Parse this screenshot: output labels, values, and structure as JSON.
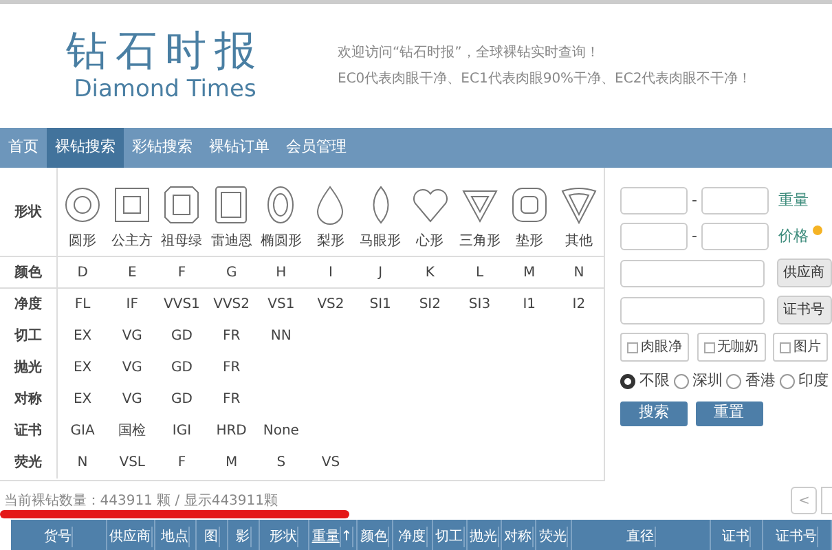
{
  "header": {
    "logo_title": "钻石时报",
    "logo_subtitle": "Diamond Times",
    "notices": [
      "欢迎访问“钻石时报”，全球裸钻实时查询！",
      "EC0代表肉眼干净、EC1代表肉眼90%干净、EC2代表肉眼不干净！"
    ]
  },
  "nav": [
    {
      "label": "首页",
      "selected": false
    },
    {
      "label": "裸钻搜索",
      "selected": true
    },
    {
      "label": "彩钻搜索",
      "selected": false
    },
    {
      "label": "裸钻订单",
      "selected": false
    },
    {
      "label": "会员管理",
      "selected": false
    }
  ],
  "filters": {
    "shape_label": "形状",
    "shapes": [
      "圆形",
      "公主方",
      "祖母绿",
      "雷迪恩",
      "椭圆形",
      "梨形",
      "马眼形",
      "心形",
      "三角形",
      "垫形",
      "其他"
    ],
    "rows": [
      {
        "label": "颜色",
        "options": [
          "D",
          "E",
          "F",
          "G",
          "H",
          "I",
          "J",
          "K",
          "L",
          "M",
          "N"
        ]
      },
      {
        "label": "净度",
        "options": [
          "FL",
          "IF",
          "VVS1",
          "VVS2",
          "VS1",
          "VS2",
          "SI1",
          "SI2",
          "SI3",
          "I1",
          "I2"
        ]
      },
      {
        "label": "切工",
        "options": [
          "EX",
          "VG",
          "GD",
          "FR",
          "NN"
        ]
      },
      {
        "label": "抛光",
        "options": [
          "EX",
          "VG",
          "GD",
          "FR"
        ]
      },
      {
        "label": "对称",
        "options": [
          "EX",
          "VG",
          "GD",
          "FR"
        ]
      },
      {
        "label": "证书",
        "options": [
          "GIA",
          "国检",
          "IGI",
          "HRD",
          "None"
        ]
      },
      {
        "label": "荧光",
        "options": [
          "N",
          "VSL",
          "F",
          "M",
          "S",
          "VS"
        ]
      }
    ]
  },
  "side": {
    "range_separator": "-",
    "weight_label": "重量",
    "price_label": "价格",
    "supplier_button": "供应商",
    "cert_button": "证书号",
    "checkboxes": [
      {
        "label": "肉眼净",
        "checked": false
      },
      {
        "label": "无咖奶",
        "checked": false
      },
      {
        "label": "图片",
        "checked": false
      }
    ],
    "locations": [
      {
        "label": "不限",
        "selected": true
      },
      {
        "label": "深圳",
        "selected": false
      },
      {
        "label": "香港",
        "selected": false
      },
      {
        "label": "印度",
        "selected": false
      }
    ],
    "search_button": "搜索",
    "reset_button": "重置"
  },
  "count_text": "当前裸钻数量：443911 颗 / 显示443911颗",
  "pager": {
    "prev": "<"
  },
  "table": {
    "columns": [
      {
        "label": "货号",
        "sorted": false
      },
      {
        "label": "供应商",
        "sorted": false
      },
      {
        "label": "地点",
        "sorted": false
      },
      {
        "label": "图",
        "sorted": false
      },
      {
        "label": "影",
        "sorted": false
      },
      {
        "label": "形状",
        "sorted": false
      },
      {
        "label": "重量",
        "sorted": true,
        "sort_mark": "↑"
      },
      {
        "label": "颜色",
        "sorted": false
      },
      {
        "label": "净度",
        "sorted": false
      },
      {
        "label": "切工",
        "sorted": false
      },
      {
        "label": "抛光",
        "sorted": false
      },
      {
        "label": "对称",
        "sorted": false
      },
      {
        "label": "荧光",
        "sorted": false
      },
      {
        "label": "直径",
        "sorted": false
      },
      {
        "label": "证书",
        "sorted": false
      },
      {
        "label": "证书号",
        "sorted": false
      }
    ]
  }
}
